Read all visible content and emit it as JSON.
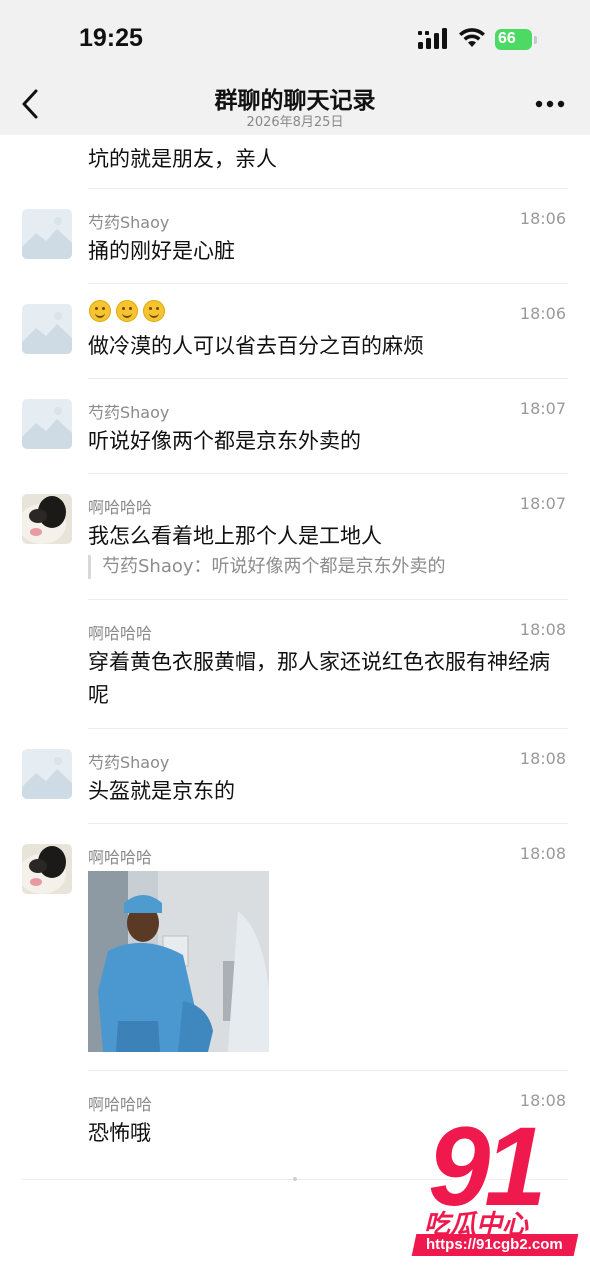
{
  "status_bar": {
    "time": "19:25",
    "battery": "66",
    "icons": [
      "cellular-signal-icon",
      "wifi-icon",
      "battery-charging-icon"
    ]
  },
  "nav": {
    "title": "群聊的聊天记录",
    "date": "2026年8月25日",
    "back_icon": "chevron-left-icon",
    "more_icon": "more-dots-icon"
  },
  "partial_message": {
    "text": "坑的就是朋友，亲人"
  },
  "messages": [
    {
      "sender": "芍药Shaoy",
      "time": "18:06",
      "text": "捅的刚好是心脏",
      "avatar": "placeholder-image"
    },
    {
      "sender": "",
      "time": "18:06",
      "emoji_count": 3,
      "emoji_name": "smile-emoji",
      "text": "做冷漠的人可以省去百分之百的麻烦",
      "avatar": "placeholder-image"
    },
    {
      "sender": "芍药Shaoy",
      "time": "18:07",
      "text": "听说好像两个都是京东外卖的",
      "avatar": "placeholder-image"
    },
    {
      "sender": "啊哈哈哈",
      "time": "18:07",
      "text": "我怎么看着地上那个人是工地人",
      "quote": "芍药Shaoy：听说好像两个都是京东外卖的",
      "avatar": "dog-photo"
    },
    {
      "sender": "啊哈哈哈",
      "time": "18:08",
      "text": "穿着黄色衣服黄帽，那人家还说红色衣服有神经病呢"
    },
    {
      "sender": "芍药Shaoy",
      "time": "18:08",
      "text": "头盔就是京东的",
      "avatar": "placeholder-image"
    },
    {
      "sender": "啊哈哈哈",
      "time": "18:08",
      "image": "person-in-blue-uniform-photo",
      "avatar": "dog-photo"
    },
    {
      "sender": "啊哈哈哈",
      "time": "18:08",
      "text": "恐怖哦"
    }
  ],
  "watermark": {
    "number": "91",
    "brand": "吃瓜中心",
    "url": "https://91cgb2.com"
  },
  "colors": {
    "nav_background": "#f1f1f1",
    "battery": "#4cd964",
    "watermark": "#f0194d"
  }
}
